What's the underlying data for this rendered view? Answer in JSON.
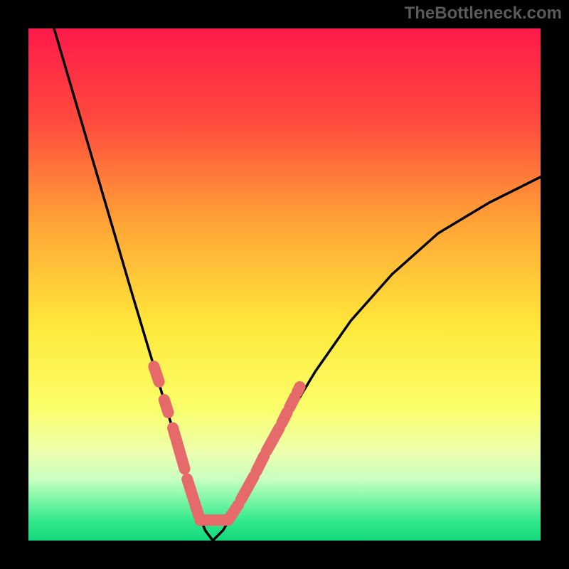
{
  "attribution": "TheBottleneck.com",
  "chart_data": {
    "type": "line",
    "title": "",
    "xlabel": "",
    "ylabel": "",
    "x_range": [
      0,
      100
    ],
    "y_range": [
      0,
      100
    ],
    "left_curve_x": [
      5,
      10,
      15,
      20,
      23,
      26,
      29,
      31,
      33,
      34.5,
      36
    ],
    "left_curve_y": [
      100,
      83,
      66,
      49,
      39,
      29,
      19,
      12,
      6,
      2,
      0
    ],
    "right_curve_x": [
      36,
      38,
      41,
      45,
      50,
      56,
      63,
      71,
      80,
      90,
      100
    ],
    "right_curve_y": [
      0,
      2,
      7,
      14,
      23,
      33,
      43,
      52,
      60,
      66,
      71
    ],
    "marker_segments": [
      {
        "side": "left",
        "x1": 24.5,
        "y1": 34,
        "x2": 25.5,
        "y2": 31
      },
      {
        "side": "left",
        "x1": 26.5,
        "y1": 27.5,
        "x2": 27.3,
        "y2": 25
      },
      {
        "side": "left",
        "x1": 28.2,
        "y1": 22,
        "x2": 30.5,
        "y2": 14
      },
      {
        "side": "left",
        "x1": 31.0,
        "y1": 12,
        "x2": 33.2,
        "y2": 5
      },
      {
        "side": "flat",
        "x1": 33.5,
        "y1": 4,
        "x2": 38.5,
        "y2": 4
      },
      {
        "side": "right",
        "x1": 39.0,
        "y1": 4,
        "x2": 41.0,
        "y2": 7
      },
      {
        "side": "right",
        "x1": 41.5,
        "y1": 8,
        "x2": 44.0,
        "y2": 12.5
      },
      {
        "side": "right",
        "x1": 44.5,
        "y1": 13.5,
        "x2": 46.0,
        "y2": 16.5
      },
      {
        "side": "right",
        "x1": 46.5,
        "y1": 17.5,
        "x2": 49.0,
        "y2": 22
      },
      {
        "side": "right",
        "x1": 49.5,
        "y1": 23,
        "x2": 50.5,
        "y2": 25
      },
      {
        "side": "right",
        "x1": 51.0,
        "y1": 26,
        "x2": 52.0,
        "y2": 28
      },
      {
        "side": "right",
        "x1": 52.5,
        "y1": 29,
        "x2": 53.0,
        "y2": 30
      }
    ],
    "gradient_stops": [
      {
        "offset": 0,
        "color": "#ff1a4a"
      },
      {
        "offset": 18,
        "color": "#ff4a3d"
      },
      {
        "offset": 38,
        "color": "#ffa436"
      },
      {
        "offset": 58,
        "color": "#ffe83a"
      },
      {
        "offset": 74,
        "color": "#fbff6a"
      },
      {
        "offset": 83,
        "color": "#ecffb0"
      },
      {
        "offset": 88,
        "color": "#c9ffc0"
      },
      {
        "offset": 92,
        "color": "#7df7a7"
      },
      {
        "offset": 96,
        "color": "#35e98d"
      },
      {
        "offset": 100,
        "color": "#12d97b"
      }
    ]
  }
}
